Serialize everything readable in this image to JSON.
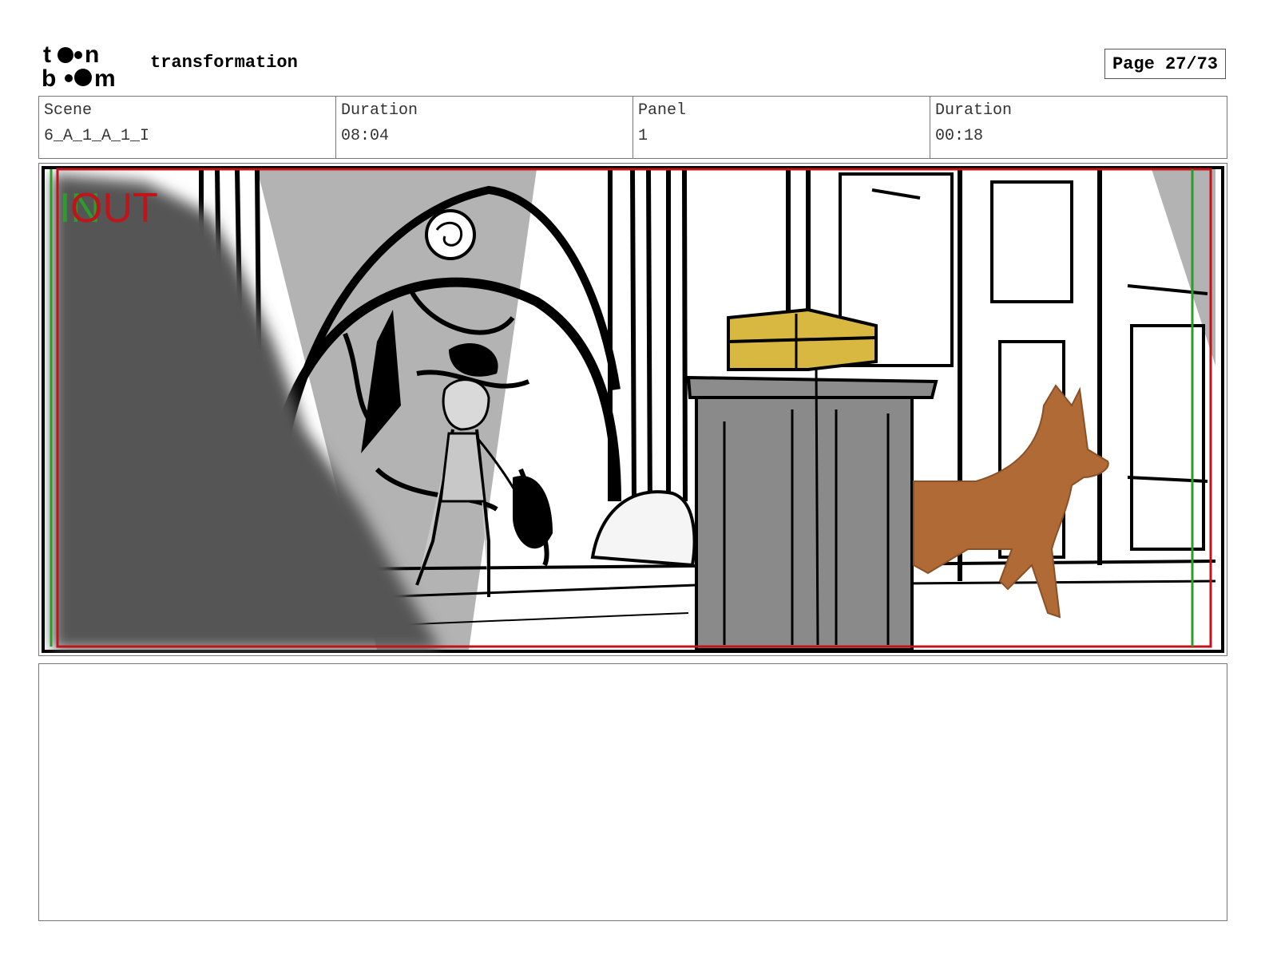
{
  "header": {
    "logo": {
      "text_top": "toon",
      "text_bottom": "boom"
    },
    "project_title": "transformation",
    "page_label": "Page 27/73"
  },
  "info": [
    {
      "label": "Scene",
      "value": "6_A_1_A_1_I"
    },
    {
      "label": "Duration",
      "value": "08:04"
    },
    {
      "label": "Panel",
      "value": "1"
    },
    {
      "label": "Duration",
      "value": "00:18"
    }
  ],
  "panel": {
    "overlay_in": "IN",
    "overlay_out": "OUT",
    "colors": {
      "in": "#2a9d2a",
      "out": "#c0141a",
      "fox": "#b06a36",
      "chest": "#d8b840",
      "gray": "#b3b3b3",
      "dark": "#545454"
    }
  },
  "notes": {
    "text": ""
  }
}
